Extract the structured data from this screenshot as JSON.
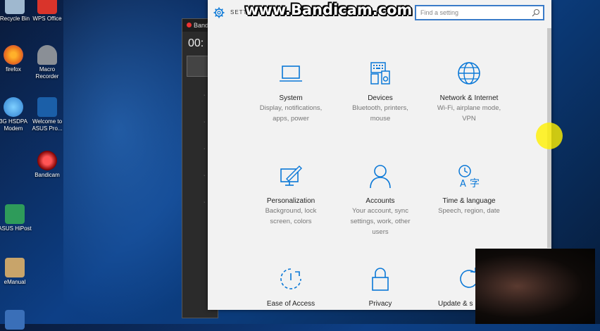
{
  "watermark": "www.Bandicam.com",
  "desktop": {
    "icons": [
      {
        "label": "Recycle Bin",
        "color": "#9fb8cf"
      },
      {
        "label": "WPS Office",
        "color": "#d9342b"
      },
      {
        "label": "firefox",
        "color": "#e8701d"
      },
      {
        "label": "Macro Recorder",
        "color": "#8a8f96"
      },
      {
        "label": "3G HSDPA Modem",
        "color": "#2f7fd0"
      },
      {
        "label": "Welcome to ASUS Pro...",
        "color": "#1b5fa8"
      },
      {
        "label": "Bandicam",
        "color": "#cc2222"
      },
      {
        "label": "ASUS HiPost",
        "color": "#2e9b5a"
      },
      {
        "label": "eManual",
        "color": "#c8a46a"
      }
    ]
  },
  "bandicam": {
    "title": "Band",
    "timer": "00:"
  },
  "settings": {
    "title": "SETTINGS",
    "search_placeholder": "Find a setting",
    "accent": "#0a78d7",
    "tiles": [
      {
        "name": "System",
        "desc1": "Display, notifications,",
        "desc2": "apps, power",
        "desc3": "",
        "icon": "laptop-icon"
      },
      {
        "name": "Devices",
        "desc1": "Bluetooth, printers,",
        "desc2": "mouse",
        "desc3": "",
        "icon": "devices-icon"
      },
      {
        "name": "Network & Internet",
        "desc1": "Wi-Fi, airplane mode,",
        "desc2": "VPN",
        "desc3": "",
        "icon": "globe-icon"
      },
      {
        "name": "Personalization",
        "desc1": "Background, lock",
        "desc2": "screen, colors",
        "desc3": "",
        "icon": "paint-icon"
      },
      {
        "name": "Accounts",
        "desc1": "Your account, sync",
        "desc2": "settings, work, other",
        "desc3": "users",
        "icon": "person-icon"
      },
      {
        "name": "Time & language",
        "desc1": "Speech, region, date",
        "desc2": "",
        "desc3": "",
        "icon": "time-language-icon"
      },
      {
        "name": "Ease of Access",
        "desc1": "",
        "desc2": "",
        "desc3": "",
        "icon": "ease-of-access-icon"
      },
      {
        "name": "Privacy",
        "desc1": "",
        "desc2": "",
        "desc3": "",
        "icon": "lock-icon"
      },
      {
        "name": "Update & s",
        "desc1": "",
        "desc2": "",
        "desc3": "",
        "icon": "update-icon"
      }
    ]
  }
}
